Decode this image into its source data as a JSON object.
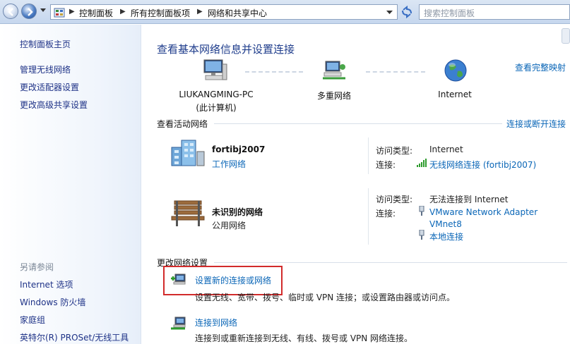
{
  "address_bar": {
    "crumbs": [
      "控制面板",
      "所有控制面板项",
      "网络和共享中心"
    ],
    "search_placeholder": "搜索控制面板"
  },
  "left_pane": {
    "home": "控制面板主页",
    "tasks": [
      "管理无线网络",
      "更改适配器设置",
      "更改高级共享设置"
    ],
    "see_also_heading": "另请参阅",
    "see_also": [
      "Internet 选项",
      "Windows 防火墙",
      "家庭组",
      "英特尔(R) PROSet/无线工具"
    ]
  },
  "main": {
    "title": "查看基本网络信息并设置连接",
    "full_map": "查看完整映射",
    "map": {
      "computer_name": "LIUKANGMING-PC",
      "computer_sub": "(此计算机)",
      "middle": "多重网络",
      "internet": "Internet"
    },
    "active_heading": "查看活动网络",
    "connect_disconnect": "连接或断开连接",
    "networks": [
      {
        "name": "fortibj2007",
        "type_link": "工作网络",
        "access_label": "访问类型:",
        "access_value": "Internet",
        "conn_label": "连接:",
        "conn_value": "无线网络连接 (fortibj2007)"
      },
      {
        "name": "未识别的网络",
        "type_text": "公用网络",
        "access_label": "访问类型:",
        "access_value": "无法连接到 Internet",
        "conn_label": "连接:",
        "conn_value_1a": "VMware Network Adapter",
        "conn_value_1b": "VMnet8",
        "conn_value_2": "本地连接"
      }
    ],
    "change_heading": "更改网络设置",
    "tasks": [
      {
        "link": "设置新的连接或网络",
        "desc": "设置无线、宽带、拨号、临时或 VPN 连接；或设置路由器或访问点。"
      },
      {
        "link": "连接到网络",
        "desc": "连接到或重新连接到无线、有线、拨号或 VPN 网络连接。"
      }
    ]
  },
  "colors": {
    "link": "#0a66b7",
    "title": "#1f3d8c",
    "highlight": "#d22b2b"
  }
}
